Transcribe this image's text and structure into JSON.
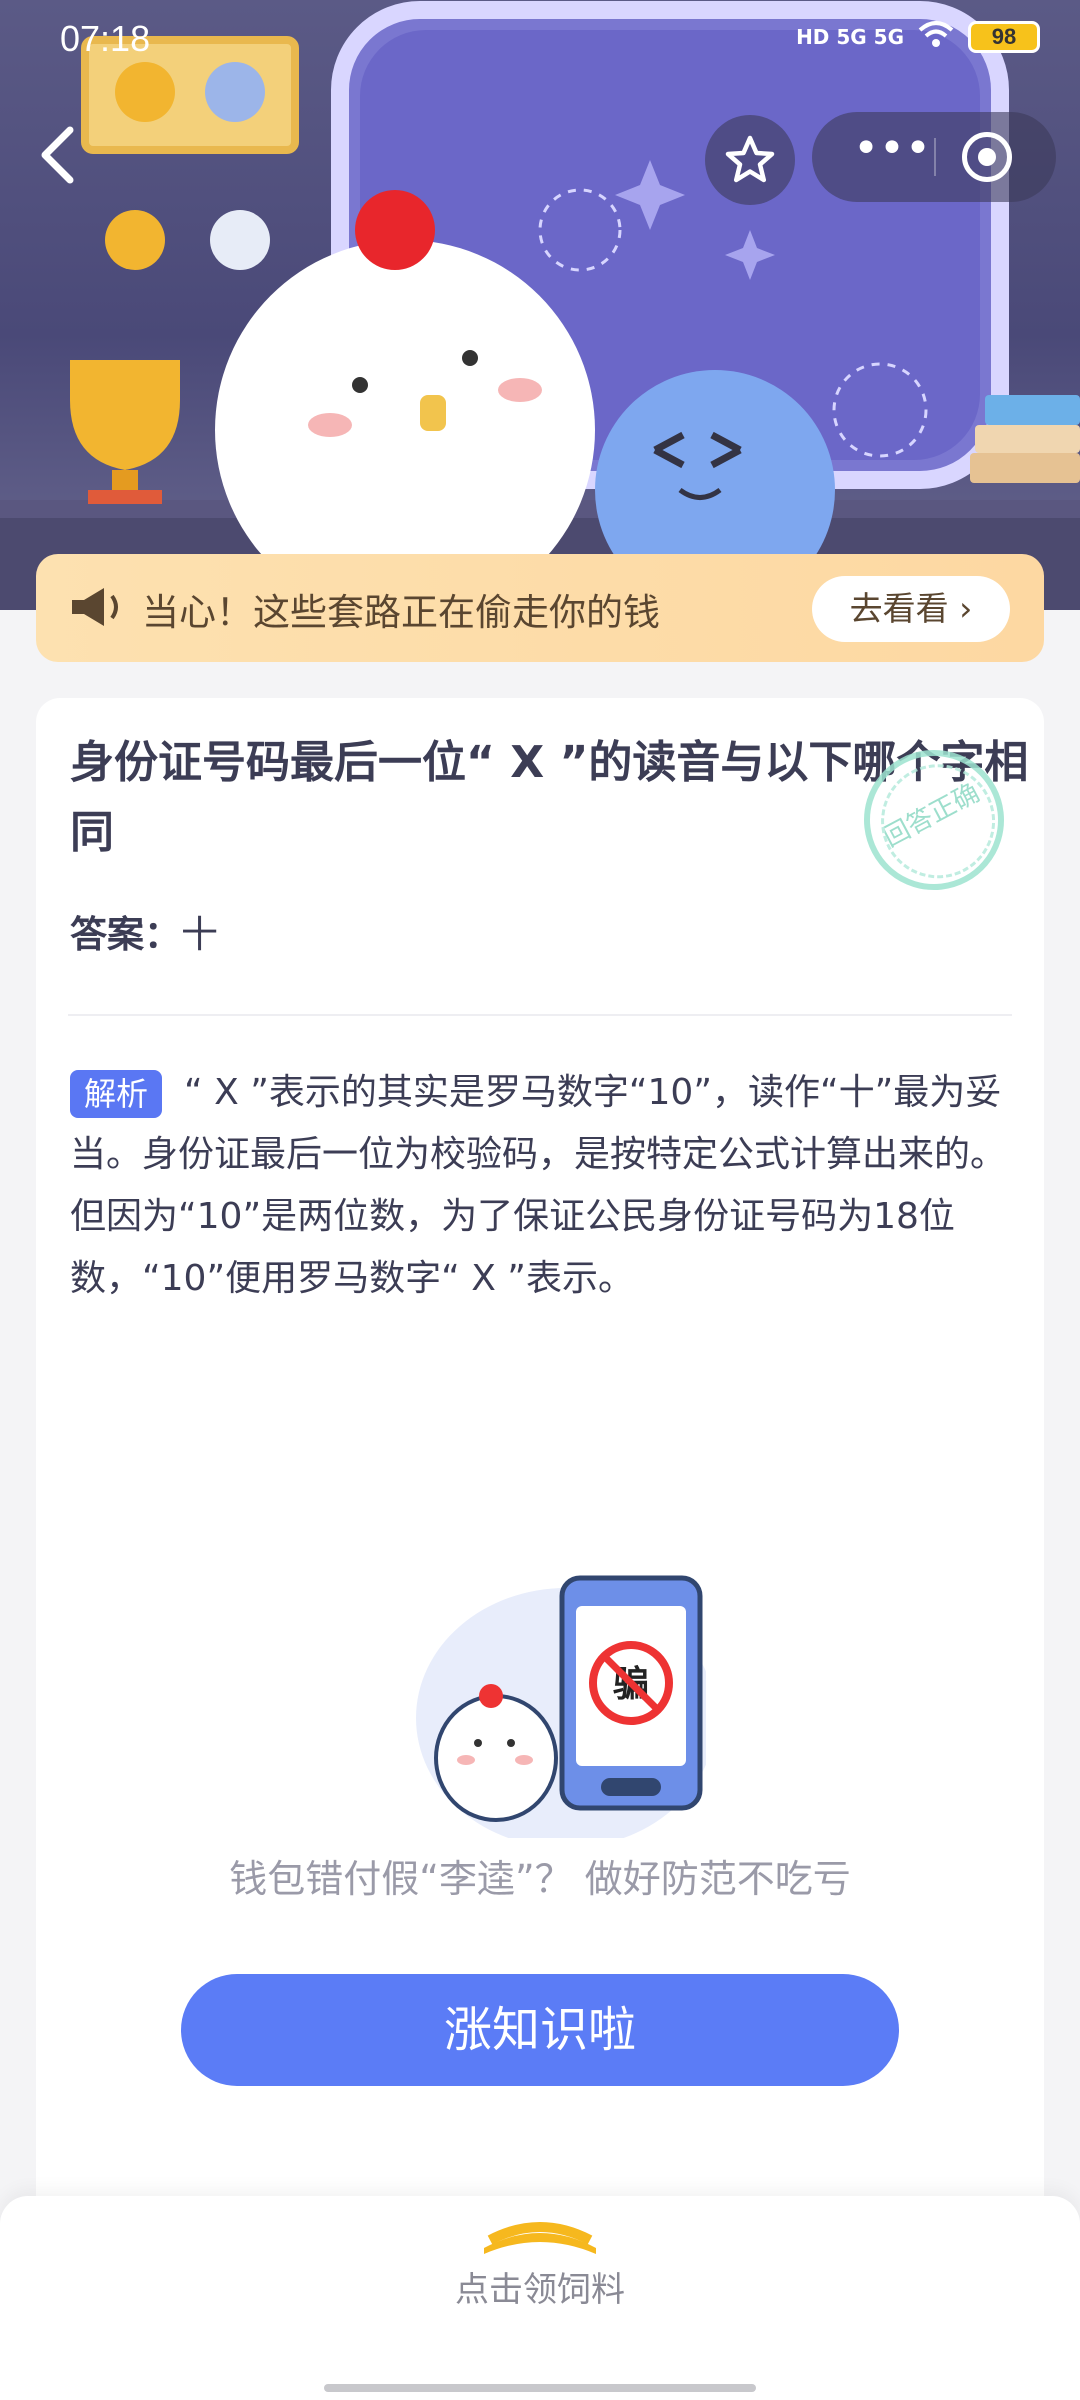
{
  "status_bar": {
    "time": "07:18",
    "network_label": "HD 5G 5G",
    "battery": "98"
  },
  "banner": {
    "text": "当心！这些套路正在偷走你的钱",
    "button": "去看看 ›"
  },
  "question": {
    "title": "身份证号码最后一位“ X ”的读音与以下哪个字相同",
    "stamp": "回答正确",
    "answer_label": "答案：",
    "answer_value": "十"
  },
  "analysis": {
    "tag": "解析",
    "text": "“ X ”表示的其实是罗马数字“10”，读作“十”最为妥当。身份证最后一位为校验码，是按特定公式计算出来的。但因为“10”是两位数，为了保证公民身份证号码为18位数，“10”便用罗马数字“ X ”表示。"
  },
  "promo": {
    "phone_text": "骗",
    "tip": "钱包错付假“李逵”？ 做好防范不吃亏",
    "button": "涨知识啦"
  },
  "bottom_bar": {
    "label": "点击领饲料"
  }
}
